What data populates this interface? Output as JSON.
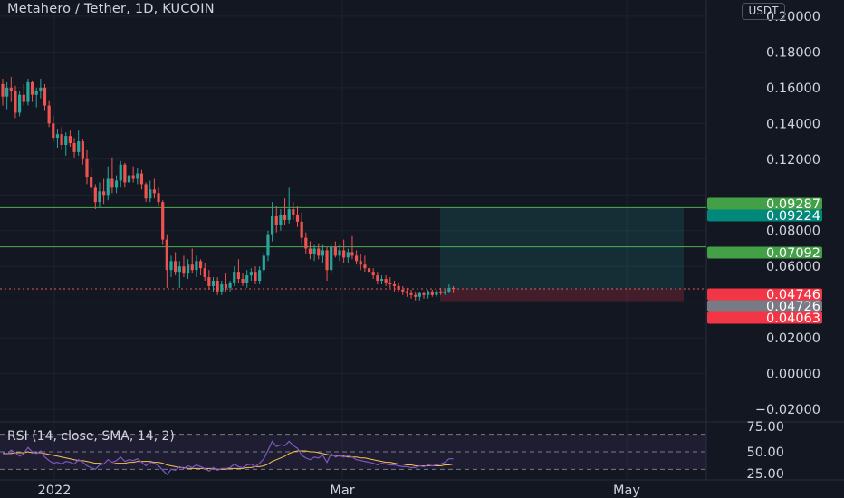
{
  "header": {
    "title": "Metahero / Tether, 1D, KUCOIN",
    "currency": "USDT"
  },
  "colors": {
    "background": "#131722",
    "up": "#26a69a",
    "down": "#ef5350",
    "rsi_line": "#7e57c2",
    "rsi_sma": "#f7c353",
    "target": "#4caf50",
    "price_badge": "#f23645",
    "gray_badge": "#787b86"
  },
  "chart_data": {
    "type": "candlestick",
    "title": "Metahero / Tether, 1D, KUCOIN",
    "y_unit": "USDT",
    "ylim": [
      -0.025,
      0.205
    ],
    "y_ticks": [
      "0.20000",
      "0.18000",
      "0.16000",
      "0.14000",
      "0.12000",
      "0.08000",
      "0.06000",
      "0.02000",
      "0.00000",
      "−0.02000"
    ],
    "x_ticks": [
      "2022",
      "Mar",
      "May"
    ],
    "price_labels": [
      {
        "value": "0.09287",
        "kind": "green"
      },
      {
        "value": "0.09224",
        "kind": "teal"
      },
      {
        "value": "0.07092",
        "kind": "green"
      },
      {
        "value": "0.04746",
        "kind": "red"
      },
      {
        "value": "0.04726",
        "kind": "gray"
      },
      {
        "value": "0.04063",
        "kind": "red"
      }
    ],
    "levels": {
      "take_profit": 0.09287,
      "target_2": 0.07092,
      "entry": 0.04726,
      "stop": 0.04063,
      "last_price": 0.04746
    },
    "candles": [
      [
        0.162,
        0.165,
        0.15,
        0.155
      ],
      [
        0.155,
        0.163,
        0.148,
        0.16
      ],
      [
        0.16,
        0.166,
        0.152,
        0.158
      ],
      [
        0.158,
        0.161,
        0.143,
        0.146
      ],
      [
        0.146,
        0.158,
        0.144,
        0.156
      ],
      [
        0.156,
        0.162,
        0.15,
        0.152
      ],
      [
        0.152,
        0.165,
        0.15,
        0.163
      ],
      [
        0.163,
        0.164,
        0.152,
        0.156
      ],
      [
        0.156,
        0.16,
        0.149,
        0.158
      ],
      [
        0.158,
        0.165,
        0.154,
        0.16
      ],
      [
        0.16,
        0.162,
        0.147,
        0.15
      ],
      [
        0.15,
        0.153,
        0.138,
        0.14
      ],
      [
        0.14,
        0.144,
        0.13,
        0.132
      ],
      [
        0.132,
        0.137,
        0.126,
        0.134
      ],
      [
        0.134,
        0.138,
        0.125,
        0.128
      ],
      [
        0.128,
        0.135,
        0.122,
        0.133
      ],
      [
        0.133,
        0.136,
        0.127,
        0.129
      ],
      [
        0.129,
        0.132,
        0.121,
        0.124
      ],
      [
        0.124,
        0.136,
        0.122,
        0.13
      ],
      [
        0.13,
        0.131,
        0.117,
        0.12
      ],
      [
        0.12,
        0.125,
        0.106,
        0.11
      ],
      [
        0.11,
        0.115,
        0.101,
        0.104
      ],
      [
        0.104,
        0.106,
        0.092,
        0.096
      ],
      [
        0.096,
        0.107,
        0.093,
        0.102
      ],
      [
        0.102,
        0.109,
        0.095,
        0.1
      ],
      [
        0.1,
        0.116,
        0.097,
        0.109
      ],
      [
        0.109,
        0.121,
        0.101,
        0.104
      ],
      [
        0.104,
        0.111,
        0.101,
        0.108
      ],
      [
        0.108,
        0.119,
        0.104,
        0.117
      ],
      [
        0.117,
        0.118,
        0.104,
        0.107
      ],
      [
        0.107,
        0.113,
        0.103,
        0.111
      ],
      [
        0.111,
        0.116,
        0.107,
        0.109
      ],
      [
        0.109,
        0.115,
        0.106,
        0.112
      ],
      [
        0.112,
        0.114,
        0.103,
        0.106
      ],
      [
        0.106,
        0.107,
        0.096,
        0.098
      ],
      [
        0.098,
        0.108,
        0.096,
        0.103
      ],
      [
        0.103,
        0.109,
        0.098,
        0.101
      ],
      [
        0.101,
        0.104,
        0.094,
        0.096
      ],
      [
        0.096,
        0.097,
        0.072,
        0.075
      ],
      [
        0.075,
        0.078,
        0.048,
        0.058
      ],
      [
        0.058,
        0.066,
        0.054,
        0.063
      ],
      [
        0.063,
        0.068,
        0.055,
        0.057
      ],
      [
        0.057,
        0.063,
        0.048,
        0.06
      ],
      [
        0.06,
        0.066,
        0.054,
        0.056
      ],
      [
        0.056,
        0.064,
        0.053,
        0.061
      ],
      [
        0.061,
        0.07,
        0.056,
        0.058
      ],
      [
        0.058,
        0.066,
        0.054,
        0.063
      ],
      [
        0.063,
        0.064,
        0.055,
        0.059
      ],
      [
        0.059,
        0.062,
        0.052,
        0.054
      ],
      [
        0.054,
        0.058,
        0.047,
        0.049
      ],
      [
        0.049,
        0.054,
        0.046,
        0.052
      ],
      [
        0.052,
        0.054,
        0.044,
        0.046
      ],
      [
        0.046,
        0.052,
        0.044,
        0.05
      ],
      [
        0.05,
        0.056,
        0.046,
        0.048
      ],
      [
        0.048,
        0.052,
        0.046,
        0.051
      ],
      [
        0.051,
        0.06,
        0.049,
        0.057
      ],
      [
        0.057,
        0.064,
        0.051,
        0.053
      ],
      [
        0.053,
        0.056,
        0.049,
        0.051
      ],
      [
        0.051,
        0.058,
        0.048,
        0.055
      ],
      [
        0.055,
        0.059,
        0.052,
        0.057
      ],
      [
        0.057,
        0.06,
        0.05,
        0.052
      ],
      [
        0.052,
        0.06,
        0.05,
        0.058
      ],
      [
        0.058,
        0.068,
        0.056,
        0.066
      ],
      [
        0.066,
        0.08,
        0.063,
        0.078
      ],
      [
        0.078,
        0.096,
        0.074,
        0.088
      ],
      [
        0.088,
        0.094,
        0.079,
        0.083
      ],
      [
        0.083,
        0.092,
        0.08,
        0.089
      ],
      [
        0.089,
        0.098,
        0.083,
        0.086
      ],
      [
        0.086,
        0.104,
        0.084,
        0.092
      ],
      [
        0.092,
        0.096,
        0.086,
        0.089
      ],
      [
        0.089,
        0.094,
        0.082,
        0.085
      ],
      [
        0.085,
        0.09,
        0.072,
        0.076
      ],
      [
        0.076,
        0.079,
        0.067,
        0.07
      ],
      [
        0.07,
        0.074,
        0.064,
        0.067
      ],
      [
        0.067,
        0.072,
        0.063,
        0.07
      ],
      [
        0.07,
        0.073,
        0.064,
        0.066
      ],
      [
        0.066,
        0.072,
        0.062,
        0.069
      ],
      [
        0.069,
        0.071,
        0.052,
        0.058
      ],
      [
        0.058,
        0.073,
        0.056,
        0.071
      ],
      [
        0.071,
        0.074,
        0.065,
        0.066
      ],
      [
        0.066,
        0.072,
        0.063,
        0.069
      ],
      [
        0.069,
        0.075,
        0.062,
        0.065
      ],
      [
        0.065,
        0.07,
        0.062,
        0.068
      ],
      [
        0.068,
        0.077,
        0.064,
        0.066
      ],
      [
        0.066,
        0.069,
        0.061,
        0.063
      ],
      [
        0.063,
        0.067,
        0.058,
        0.061
      ],
      [
        0.061,
        0.066,
        0.057,
        0.059
      ],
      [
        0.059,
        0.062,
        0.055,
        0.057
      ],
      [
        0.057,
        0.059,
        0.053,
        0.055
      ],
      [
        0.055,
        0.057,
        0.05,
        0.052
      ],
      [
        0.052,
        0.055,
        0.05,
        0.053
      ],
      [
        0.053,
        0.055,
        0.049,
        0.051
      ],
      [
        0.051,
        0.054,
        0.048,
        0.05
      ],
      [
        0.05,
        0.052,
        0.046,
        0.049
      ],
      [
        0.049,
        0.051,
        0.046,
        0.047
      ],
      [
        0.047,
        0.049,
        0.044,
        0.046
      ],
      [
        0.046,
        0.048,
        0.043,
        0.045
      ],
      [
        0.045,
        0.047,
        0.042,
        0.044
      ],
      [
        0.044,
        0.046,
        0.041,
        0.043
      ],
      [
        0.043,
        0.046,
        0.041,
        0.045
      ],
      [
        0.045,
        0.046,
        0.042,
        0.044
      ],
      [
        0.044,
        0.047,
        0.042,
        0.046
      ],
      [
        0.046,
        0.047,
        0.043,
        0.044
      ],
      [
        0.044,
        0.047,
        0.043,
        0.046
      ],
      [
        0.046,
        0.048,
        0.044,
        0.045
      ],
      [
        0.045,
        0.047,
        0.044,
        0.046
      ],
      [
        0.046,
        0.05,
        0.045,
        0.048
      ],
      [
        0.048,
        0.049,
        0.045,
        0.0474
      ]
    ],
    "rsi": {
      "label": "RSI (14, close, SMA, 14, 2)",
      "ylim": [
        20,
        80
      ],
      "y_ticks": [
        "75.00",
        "50.00",
        "25.00"
      ],
      "bands": [
        70,
        50,
        30
      ],
      "rsi_values": [
        50,
        47,
        52,
        49,
        45,
        48,
        55,
        50,
        48,
        51,
        44,
        40,
        37,
        38,
        36,
        39,
        38,
        36,
        41,
        38,
        34,
        32,
        30,
        35,
        36,
        41,
        38,
        40,
        44,
        39,
        41,
        40,
        42,
        38,
        34,
        38,
        37,
        34,
        29,
        24,
        30,
        29,
        33,
        31,
        34,
        32,
        35,
        33,
        31,
        28,
        32,
        29,
        31,
        31,
        32,
        36,
        33,
        32,
        35,
        36,
        33,
        37,
        42,
        52,
        62,
        56,
        58,
        57,
        62,
        57,
        54,
        46,
        43,
        41,
        44,
        43,
        46,
        38,
        48,
        44,
        46,
        44,
        46,
        44,
        41,
        40,
        39,
        38,
        37,
        35,
        37,
        36,
        35,
        35,
        34,
        33,
        33,
        32,
        32,
        34,
        33,
        35,
        34,
        35,
        36,
        38,
        42,
        42
      ],
      "sma_values": [
        48,
        48,
        48,
        49,
        49,
        49,
        50,
        49,
        49,
        49,
        48,
        47,
        46,
        45,
        44,
        43,
        42,
        41,
        40,
        40,
        39,
        38,
        37,
        37,
        36,
        36,
        36,
        37,
        37,
        37,
        38,
        38,
        39,
        39,
        39,
        39,
        38,
        38,
        37,
        35,
        34,
        33,
        32,
        32,
        31,
        31,
        31,
        31,
        31,
        31,
        31,
        30,
        30,
        30,
        31,
        31,
        31,
        31,
        32,
        32,
        33,
        33,
        34,
        36,
        39,
        41,
        43,
        45,
        48,
        50,
        51,
        51,
        51,
        50,
        50,
        49,
        48,
        47,
        46,
        46,
        45,
        45,
        44,
        44,
        44,
        43,
        43,
        42,
        41,
        40,
        39,
        38,
        38,
        37,
        36,
        36,
        35,
        35,
        34,
        34,
        34,
        34,
        34,
        34,
        34,
        35,
        35,
        36
      ]
    }
  }
}
